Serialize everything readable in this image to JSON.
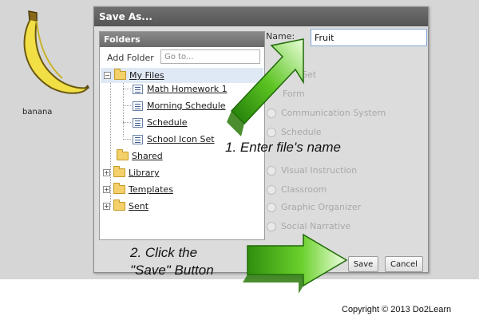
{
  "dialog": {
    "title": "Save As..."
  },
  "clipart": {
    "label": "banana",
    "icon": "banana-icon"
  },
  "folders": {
    "header": "Folders",
    "add_folder_label": "Add Folder",
    "goto_placeholder": "Go to...",
    "tree": [
      {
        "label": "My Files",
        "type": "folder",
        "expanded": true,
        "selected": true
      },
      {
        "label": "Math Homework 1",
        "type": "file"
      },
      {
        "label": "Morning Schedule",
        "type": "file"
      },
      {
        "label": "Schedule",
        "type": "file"
      },
      {
        "label": "School Icon Set",
        "type": "file"
      },
      {
        "label": "Shared",
        "type": "folder"
      },
      {
        "label": "Library",
        "type": "folder",
        "expanded": false
      },
      {
        "label": "Templates",
        "type": "folder",
        "expanded": false
      },
      {
        "label": "Sent",
        "type": "folder",
        "expanded": false
      }
    ]
  },
  "name_field": {
    "label": "Name:",
    "value": "Fruit"
  },
  "categories": [
    {
      "label": "Set",
      "disabled": true
    },
    {
      "label": "Form",
      "disabled": true
    },
    {
      "label": "Communication System",
      "disabled": true
    },
    {
      "label": "Schedule",
      "disabled": true
    },
    {
      "label": "",
      "disabled": true
    },
    {
      "label": "Visual Instruction",
      "disabled": true
    },
    {
      "label": "Classroom",
      "disabled": true
    },
    {
      "label": "Graphic Organizer",
      "disabled": true
    },
    {
      "label": "Social Narrative",
      "disabled": true
    }
  ],
  "buttons": {
    "save": "Save",
    "cancel": "Cancel"
  },
  "instructions": {
    "step1": "1. Enter file's name",
    "step2_line1": "2. Click the",
    "step2_line2": "\"Save\" Button"
  },
  "footer": {
    "copyright": "Copyright © 2013 Do2Learn"
  },
  "colors": {
    "arrow_green": "#5cc422",
    "arrow_dark_green": "#2a7a0a",
    "header_gray": "#6a6a6a",
    "selected_row": "#dfe9f6"
  }
}
